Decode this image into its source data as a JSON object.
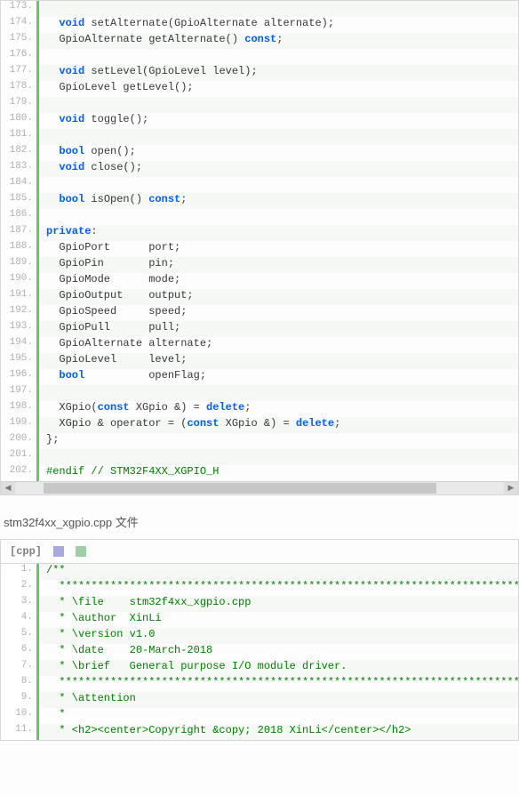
{
  "chart_data": null,
  "top_code": [
    {
      "n": 173,
      "h": ""
    },
    {
      "n": 174,
      "h": "  <span class='kw'>void</span> setAlternate(GpioAlternate alternate);"
    },
    {
      "n": 175,
      "h": "  GpioAlternate getAlternate() <span class='kw'>const</span>;"
    },
    {
      "n": 176,
      "h": ""
    },
    {
      "n": 177,
      "h": "  <span class='kw'>void</span> setLevel(GpioLevel level);"
    },
    {
      "n": 178,
      "h": "  GpioLevel getLevel();"
    },
    {
      "n": 179,
      "h": ""
    },
    {
      "n": 180,
      "h": "  <span class='kw'>void</span> toggle();"
    },
    {
      "n": 181,
      "h": ""
    },
    {
      "n": 182,
      "h": "  <span class='kw'>bool</span> open();"
    },
    {
      "n": 183,
      "h": "  <span class='kw'>void</span> close();"
    },
    {
      "n": 184,
      "h": ""
    },
    {
      "n": 185,
      "h": "  <span class='kw'>bool</span> isOpen() <span class='kw'>const</span>;"
    },
    {
      "n": 186,
      "h": ""
    },
    {
      "n": 187,
      "h": "<span class='kw'>private</span>:"
    },
    {
      "n": 188,
      "h": "  GpioPort      port;"
    },
    {
      "n": 189,
      "h": "  GpioPin       pin;"
    },
    {
      "n": 190,
      "h": "  GpioMode      mode;"
    },
    {
      "n": 191,
      "h": "  GpioOutput    output;"
    },
    {
      "n": 192,
      "h": "  GpioSpeed     speed;"
    },
    {
      "n": 193,
      "h": "  GpioPull      pull;"
    },
    {
      "n": 194,
      "h": "  GpioAlternate alternate;"
    },
    {
      "n": 195,
      "h": "  GpioLevel     level;"
    },
    {
      "n": 196,
      "h": "  <span class='kw'>bool</span>          openFlag;"
    },
    {
      "n": 197,
      "h": ""
    },
    {
      "n": 198,
      "h": "  XGpio(<span class='kw'>const</span> XGpio &amp;) = <span class='kw'>delete</span>;"
    },
    {
      "n": 199,
      "h": "  XGpio &amp; operator = (<span class='kw'>const</span> XGpio &amp;) = <span class='kw'>delete</span>;"
    },
    {
      "n": 200,
      "h": "};"
    },
    {
      "n": 201,
      "h": ""
    },
    {
      "n": 202,
      "h": "<span class='cm'>#endif // STM32F4XX_XGPIO_H</span>"
    }
  ],
  "section_title": "stm32f4xx_xgpio.cpp 文件",
  "lang_label": "[cpp]",
  "bot_code": [
    {
      "n": 1,
      "h": "<span class='cm'>/**</span>"
    },
    {
      "n": 2,
      "h": "<span class='cm'>  ******************************************************************************</span>"
    },
    {
      "n": 3,
      "h": "<span class='cm'>  * \\file    stm32f4xx_xgpio.cpp</span>"
    },
    {
      "n": 4,
      "h": "<span class='cm'>  * \\author  XinLi</span>"
    },
    {
      "n": 5,
      "h": "<span class='cm'>  * \\version v1.0</span>"
    },
    {
      "n": 6,
      "h": "<span class='cm'>  * \\date    20-March-2018</span>"
    },
    {
      "n": 7,
      "h": "<span class='cm'>  * \\brief   General purpose I/O module driver.</span>"
    },
    {
      "n": 8,
      "h": "<span class='cm'>  ******************************************************************************</span>"
    },
    {
      "n": 9,
      "h": "<span class='cm'>  * \\attention</span>"
    },
    {
      "n": 10,
      "h": "<span class='cm'>  *</span>"
    },
    {
      "n": 11,
      "h": "<span class='cm'>  * &lt;h2&gt;&lt;center&gt;Copyright &amp;copy; 2018 XinLi&lt;/center&gt;&lt;/h2&gt;</span>"
    }
  ]
}
